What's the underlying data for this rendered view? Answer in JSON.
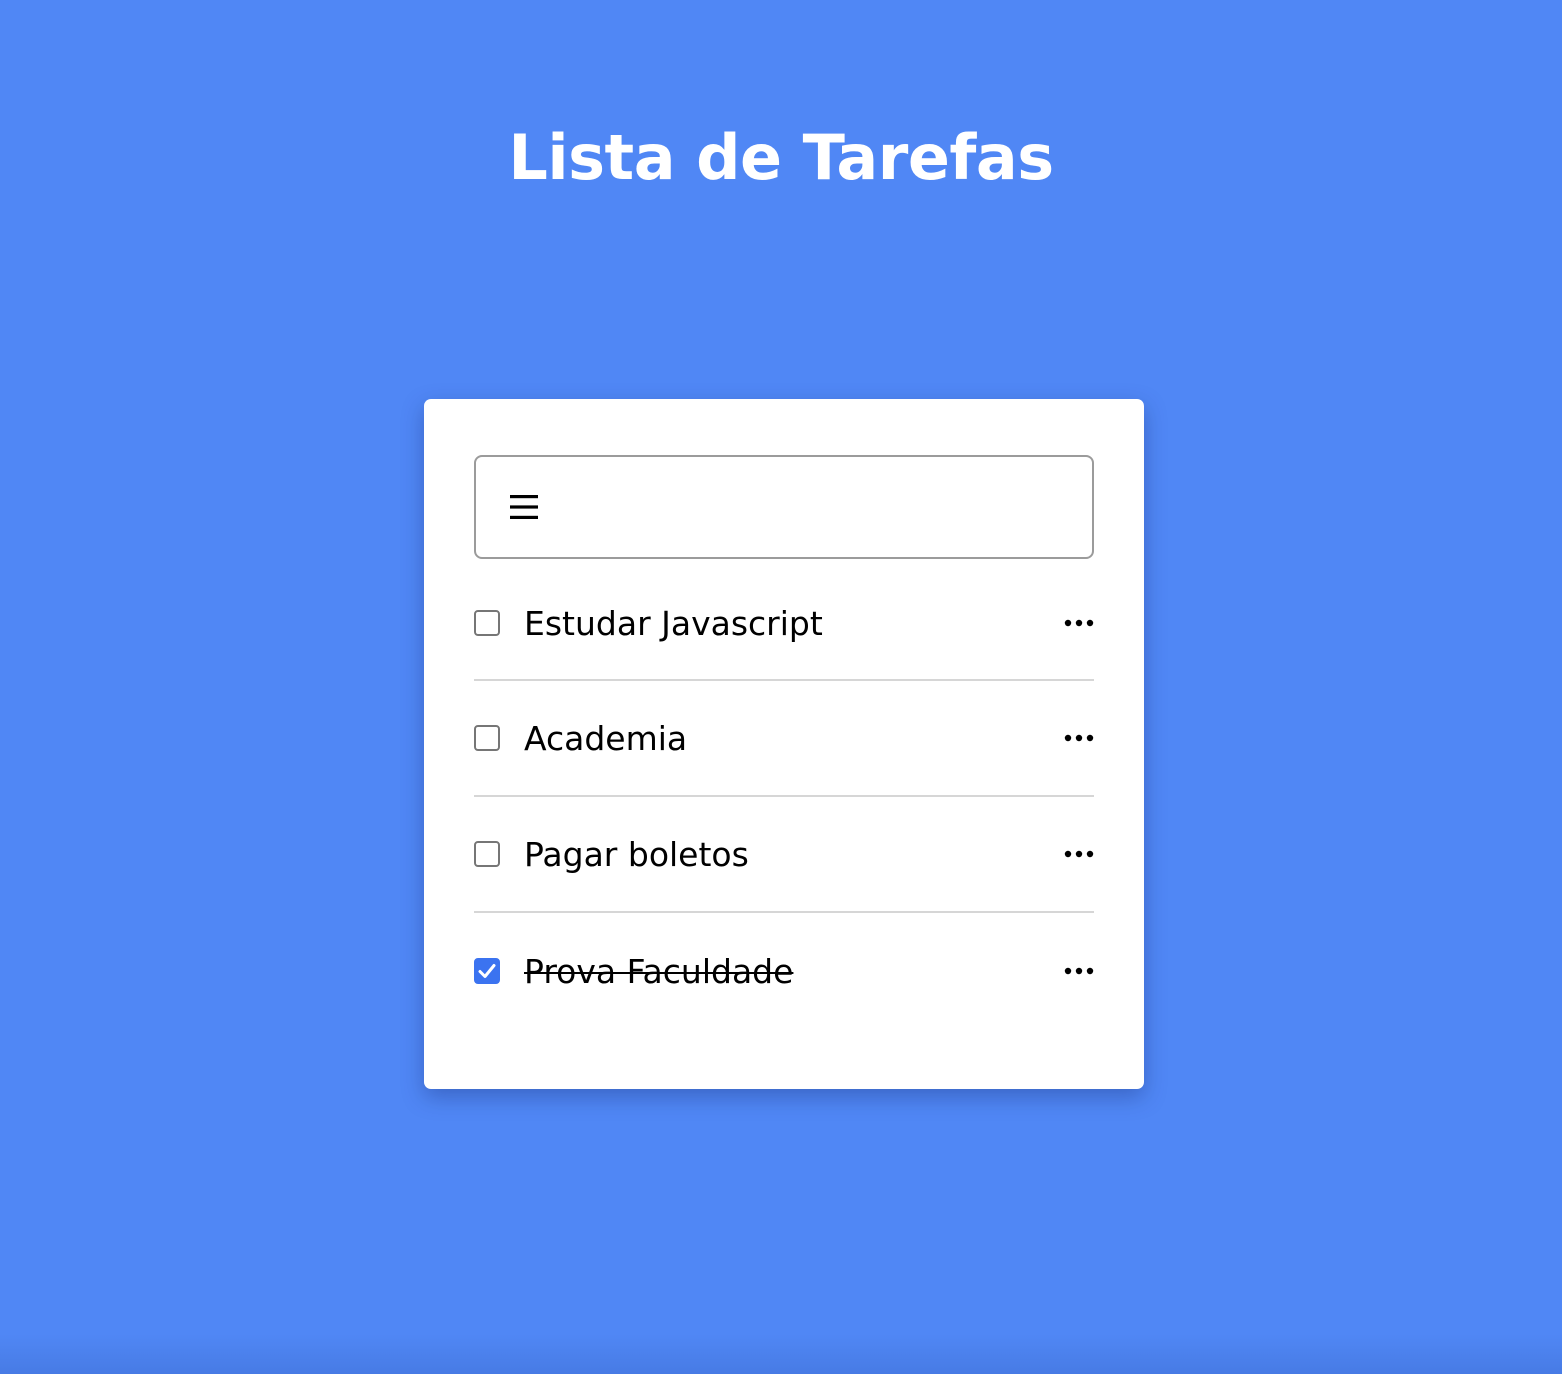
{
  "header": {
    "title": "Lista de Tarefas"
  },
  "input": {
    "value": "",
    "placeholder": "",
    "icon": "menu-icon"
  },
  "tasks": [
    {
      "label": "Estudar Javascript",
      "done": false
    },
    {
      "label": "Academia",
      "done": false
    },
    {
      "label": "Pagar boletos",
      "done": false
    },
    {
      "label": "Prova Faculdade",
      "done": true
    }
  ],
  "icons": {
    "more": "more-horizontal-icon",
    "check": "checkmark-icon"
  },
  "colors": {
    "background": "#5087f5",
    "card": "#ffffff",
    "checkbox_checked": "#3b73f0",
    "divider": "#d6d6d6"
  }
}
